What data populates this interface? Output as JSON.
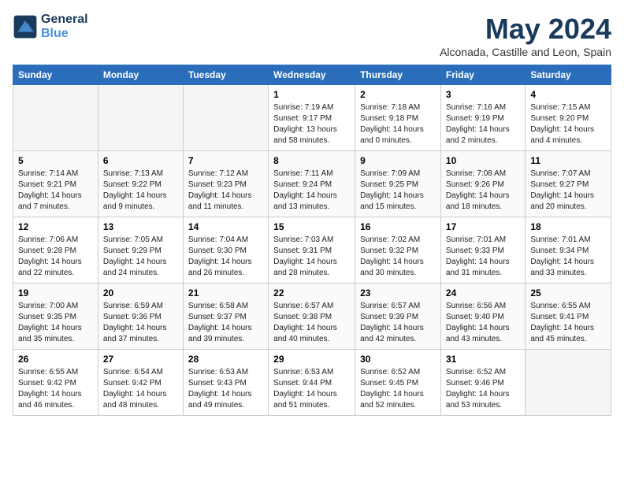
{
  "header": {
    "logo_line1": "General",
    "logo_line2": "Blue",
    "month_title": "May 2024",
    "subtitle": "Alconada, Castille and Leon, Spain"
  },
  "days_of_week": [
    "Sunday",
    "Monday",
    "Tuesday",
    "Wednesday",
    "Thursday",
    "Friday",
    "Saturday"
  ],
  "weeks": [
    [
      {
        "day": "",
        "info": ""
      },
      {
        "day": "",
        "info": ""
      },
      {
        "day": "",
        "info": ""
      },
      {
        "day": "1",
        "info": "Sunrise: 7:19 AM\nSunset: 9:17 PM\nDaylight: 13 hours and 58 minutes."
      },
      {
        "day": "2",
        "info": "Sunrise: 7:18 AM\nSunset: 9:18 PM\nDaylight: 14 hours and 0 minutes."
      },
      {
        "day": "3",
        "info": "Sunrise: 7:16 AM\nSunset: 9:19 PM\nDaylight: 14 hours and 2 minutes."
      },
      {
        "day": "4",
        "info": "Sunrise: 7:15 AM\nSunset: 9:20 PM\nDaylight: 14 hours and 4 minutes."
      }
    ],
    [
      {
        "day": "5",
        "info": "Sunrise: 7:14 AM\nSunset: 9:21 PM\nDaylight: 14 hours and 7 minutes."
      },
      {
        "day": "6",
        "info": "Sunrise: 7:13 AM\nSunset: 9:22 PM\nDaylight: 14 hours and 9 minutes."
      },
      {
        "day": "7",
        "info": "Sunrise: 7:12 AM\nSunset: 9:23 PM\nDaylight: 14 hours and 11 minutes."
      },
      {
        "day": "8",
        "info": "Sunrise: 7:11 AM\nSunset: 9:24 PM\nDaylight: 14 hours and 13 minutes."
      },
      {
        "day": "9",
        "info": "Sunrise: 7:09 AM\nSunset: 9:25 PM\nDaylight: 14 hours and 15 minutes."
      },
      {
        "day": "10",
        "info": "Sunrise: 7:08 AM\nSunset: 9:26 PM\nDaylight: 14 hours and 18 minutes."
      },
      {
        "day": "11",
        "info": "Sunrise: 7:07 AM\nSunset: 9:27 PM\nDaylight: 14 hours and 20 minutes."
      }
    ],
    [
      {
        "day": "12",
        "info": "Sunrise: 7:06 AM\nSunset: 9:28 PM\nDaylight: 14 hours and 22 minutes."
      },
      {
        "day": "13",
        "info": "Sunrise: 7:05 AM\nSunset: 9:29 PM\nDaylight: 14 hours and 24 minutes."
      },
      {
        "day": "14",
        "info": "Sunrise: 7:04 AM\nSunset: 9:30 PM\nDaylight: 14 hours and 26 minutes."
      },
      {
        "day": "15",
        "info": "Sunrise: 7:03 AM\nSunset: 9:31 PM\nDaylight: 14 hours and 28 minutes."
      },
      {
        "day": "16",
        "info": "Sunrise: 7:02 AM\nSunset: 9:32 PM\nDaylight: 14 hours and 30 minutes."
      },
      {
        "day": "17",
        "info": "Sunrise: 7:01 AM\nSunset: 9:33 PM\nDaylight: 14 hours and 31 minutes."
      },
      {
        "day": "18",
        "info": "Sunrise: 7:01 AM\nSunset: 9:34 PM\nDaylight: 14 hours and 33 minutes."
      }
    ],
    [
      {
        "day": "19",
        "info": "Sunrise: 7:00 AM\nSunset: 9:35 PM\nDaylight: 14 hours and 35 minutes."
      },
      {
        "day": "20",
        "info": "Sunrise: 6:59 AM\nSunset: 9:36 PM\nDaylight: 14 hours and 37 minutes."
      },
      {
        "day": "21",
        "info": "Sunrise: 6:58 AM\nSunset: 9:37 PM\nDaylight: 14 hours and 39 minutes."
      },
      {
        "day": "22",
        "info": "Sunrise: 6:57 AM\nSunset: 9:38 PM\nDaylight: 14 hours and 40 minutes."
      },
      {
        "day": "23",
        "info": "Sunrise: 6:57 AM\nSunset: 9:39 PM\nDaylight: 14 hours and 42 minutes."
      },
      {
        "day": "24",
        "info": "Sunrise: 6:56 AM\nSunset: 9:40 PM\nDaylight: 14 hours and 43 minutes."
      },
      {
        "day": "25",
        "info": "Sunrise: 6:55 AM\nSunset: 9:41 PM\nDaylight: 14 hours and 45 minutes."
      }
    ],
    [
      {
        "day": "26",
        "info": "Sunrise: 6:55 AM\nSunset: 9:42 PM\nDaylight: 14 hours and 46 minutes."
      },
      {
        "day": "27",
        "info": "Sunrise: 6:54 AM\nSunset: 9:42 PM\nDaylight: 14 hours and 48 minutes."
      },
      {
        "day": "28",
        "info": "Sunrise: 6:53 AM\nSunset: 9:43 PM\nDaylight: 14 hours and 49 minutes."
      },
      {
        "day": "29",
        "info": "Sunrise: 6:53 AM\nSunset: 9:44 PM\nDaylight: 14 hours and 51 minutes."
      },
      {
        "day": "30",
        "info": "Sunrise: 6:52 AM\nSunset: 9:45 PM\nDaylight: 14 hours and 52 minutes."
      },
      {
        "day": "31",
        "info": "Sunrise: 6:52 AM\nSunset: 9:46 PM\nDaylight: 14 hours and 53 minutes."
      },
      {
        "day": "",
        "info": ""
      }
    ]
  ]
}
